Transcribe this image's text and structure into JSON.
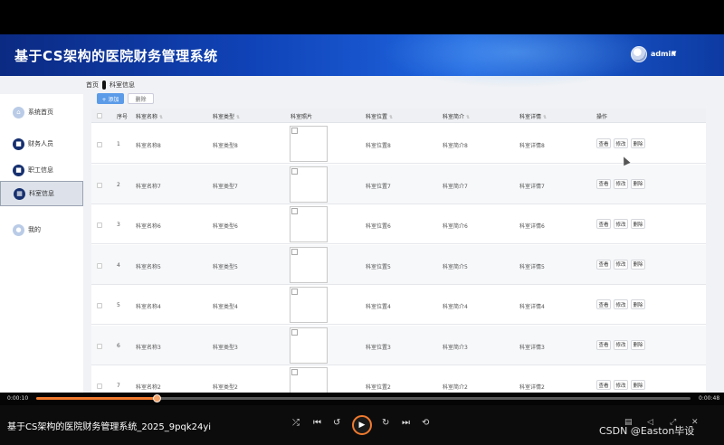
{
  "app": {
    "title": "基于CS架构的医院财务管理系统",
    "user": "admin"
  },
  "breadcrumb": {
    "home": "首页",
    "current": "科室信息"
  },
  "sidebar": {
    "items": [
      {
        "label": "系统首页",
        "icon": "home-icon"
      },
      {
        "label": "财务人员",
        "icon": "user-icon"
      },
      {
        "label": "职工信息",
        "icon": "id-card-icon"
      },
      {
        "label": "科室信息",
        "icon": "grid-icon",
        "active": true
      },
      {
        "label": "我的",
        "icon": "profile-icon"
      }
    ]
  },
  "toolbar": {
    "add_label": "+ 添加",
    "delete_label": "删除"
  },
  "table": {
    "columns": [
      "序号",
      "科室名称",
      "科室类型",
      "科室照片",
      "科室位置",
      "科室简介",
      "科室详情",
      "操作"
    ],
    "rows": [
      {
        "no": "1",
        "name": "科室名称8",
        "type": "科室类型8",
        "location": "科室位置8",
        "intro": "科室简介8",
        "detail": "科室详情8"
      },
      {
        "no": "2",
        "name": "科室名称7",
        "type": "科室类型7",
        "location": "科室位置7",
        "intro": "科室简介7",
        "detail": "科室详情7"
      },
      {
        "no": "3",
        "name": "科室名称6",
        "type": "科室类型6",
        "location": "科室位置6",
        "intro": "科室简介6",
        "detail": "科室详情6"
      },
      {
        "no": "4",
        "name": "科室名称5",
        "type": "科室类型5",
        "location": "科室位置5",
        "intro": "科室简介5",
        "detail": "科室详情5"
      },
      {
        "no": "5",
        "name": "科室名称4",
        "type": "科室类型4",
        "location": "科室位置4",
        "intro": "科室简介4",
        "detail": "科室详情4"
      },
      {
        "no": "6",
        "name": "科室名称3",
        "type": "科室类型3",
        "location": "科室位置3",
        "intro": "科室简介3",
        "detail": "科室详情3"
      },
      {
        "no": "7",
        "name": "科室名称2",
        "type": "科室类型2",
        "location": "科室位置2",
        "intro": "科室简介2",
        "detail": "科室详情2"
      }
    ],
    "actions": {
      "view": "查看",
      "edit": "修改",
      "delete": "删除"
    }
  },
  "player": {
    "current_time": "0:00:10",
    "total_time": "0:00:48",
    "progress": 0.184,
    "video_title": "基于CS架构的医院财务管理系统_2025_9pqk24yi",
    "accent": "#f07a2e"
  },
  "watermark": "CSDN @Easton毕设"
}
